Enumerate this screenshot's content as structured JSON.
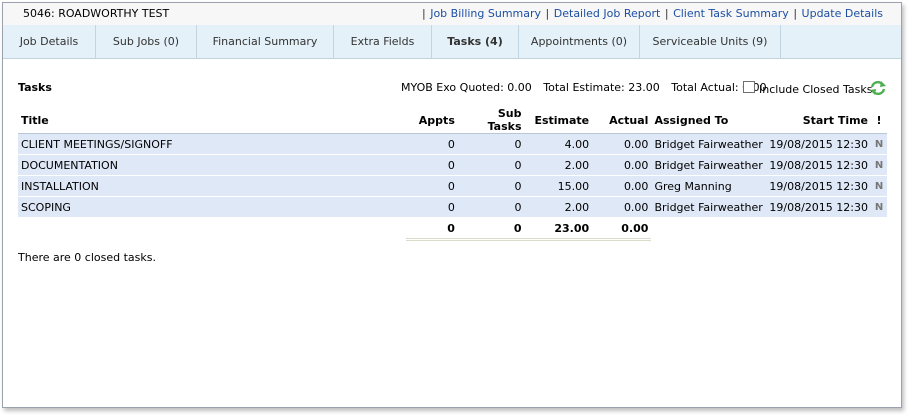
{
  "header": {
    "job_title": "5046: ROADWORTHY TEST",
    "links": [
      "Job Billing Summary",
      "Detailed Job Report",
      "Client Task Summary",
      "Update Details"
    ]
  },
  "tabs": [
    {
      "label": "Job Details",
      "active": false
    },
    {
      "label": "Sub Jobs (0)",
      "active": false
    },
    {
      "label": "Financial Summary",
      "active": false
    },
    {
      "label": "Extra Fields",
      "active": false
    },
    {
      "label": "Tasks (4)",
      "active": true
    },
    {
      "label": "Appointments (0)",
      "active": false
    },
    {
      "label": "Serviceable Units (9)",
      "active": false
    }
  ],
  "tasks_section": {
    "title": "Tasks",
    "myob_quoted": "MYOB Exo Quoted: 0.00",
    "total_estimate": "Total Estimate: 23.00",
    "total_actual": "Total Actual: 0.00",
    "include_closed_label": "Include Closed Tasks",
    "include_closed_checked": false
  },
  "table": {
    "columns": [
      "Title",
      "Appts",
      "Sub Tasks",
      "Estimate",
      "Actual",
      "Assigned To",
      "Start Time",
      "!"
    ],
    "rows": [
      {
        "title": "CLIENT MEETINGS/SIGNOFF",
        "appts": "0",
        "sub_tasks": "0",
        "estimate": "4.00",
        "actual": "0.00",
        "assigned_to": "Bridget Fairweather",
        "start_time": "19/08/2015 12:30",
        "flag": "N"
      },
      {
        "title": "DOCUMENTATION",
        "appts": "0",
        "sub_tasks": "0",
        "estimate": "2.00",
        "actual": "0.00",
        "assigned_to": "Bridget Fairweather",
        "start_time": "19/08/2015 12:30",
        "flag": "N"
      },
      {
        "title": "INSTALLATION",
        "appts": "0",
        "sub_tasks": "0",
        "estimate": "15.00",
        "actual": "0.00",
        "assigned_to": "Greg Manning",
        "start_time": "19/08/2015 12:30",
        "flag": "N"
      },
      {
        "title": "SCOPING",
        "appts": "0",
        "sub_tasks": "0",
        "estimate": "2.00",
        "actual": "0.00",
        "assigned_to": "Bridget Fairweather",
        "start_time": "19/08/2015 12:30",
        "flag": "N"
      }
    ],
    "totals": {
      "appts": "0",
      "sub_tasks": "0",
      "estimate": "23.00",
      "actual": "0.00"
    }
  },
  "closed_message": "There are 0 closed tasks.",
  "colors": {
    "tab_bg": "#e4f1f8",
    "row_bg": "#dfe8f7",
    "link": "#1c4fa3",
    "refresh": "#4caf50"
  }
}
